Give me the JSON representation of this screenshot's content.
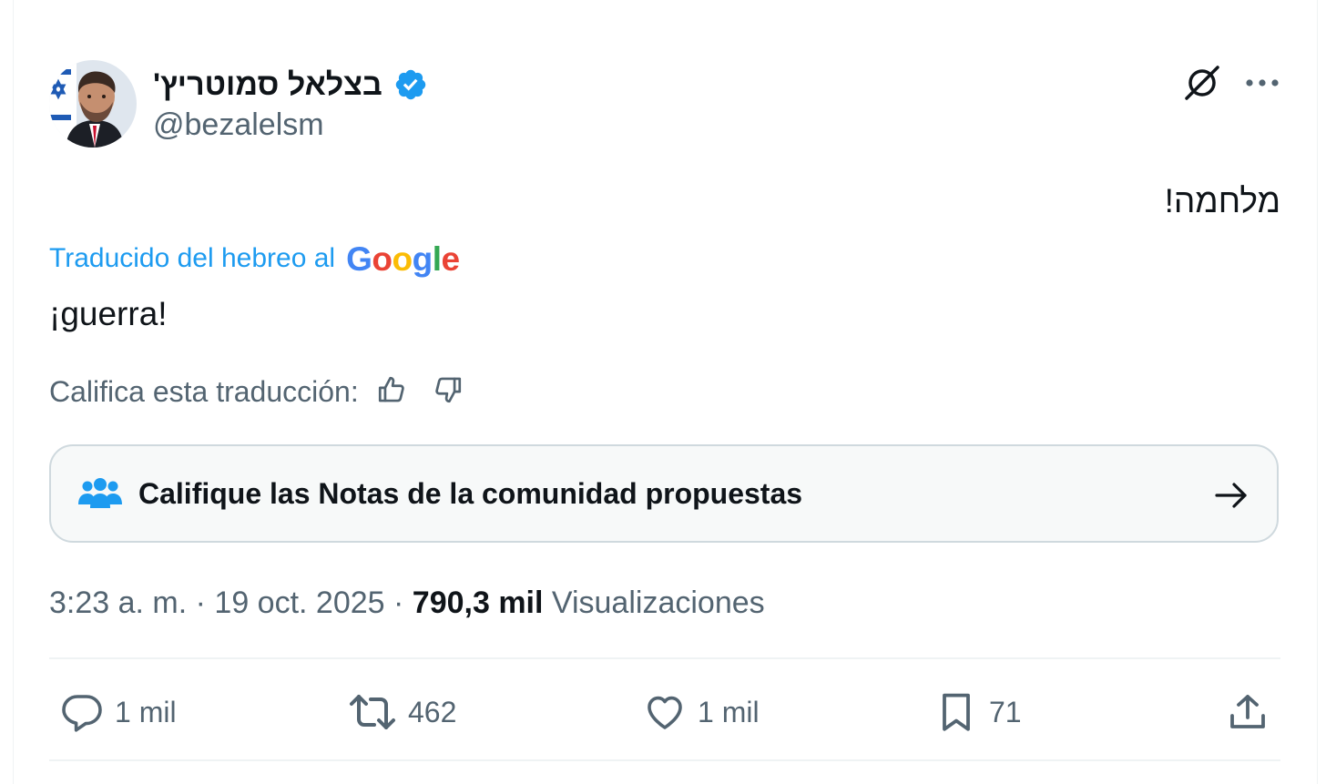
{
  "author": {
    "display_name": "בצלאל סמוטריץ'",
    "handle": "@bezalelsm",
    "verified_icon": "verified-badge-icon",
    "avatar_icon": "avatar-photo"
  },
  "header_actions": {
    "grok_icon": "grok-icon",
    "more_icon": "more-icon"
  },
  "tweet": {
    "original_text": "מלחמה!",
    "translated_label": "Traducido del hebreo al",
    "translator_logo": "Google",
    "translation": "¡guerra!"
  },
  "rate_translation": {
    "label": "Califica esta traducción:",
    "up_icon": "thumbs-up-icon",
    "down_icon": "thumbs-down-icon"
  },
  "community_notes": {
    "label": "Califique las Notas de la comunidad propuestas",
    "icon": "community-icon",
    "arrow_icon": "arrow-right-icon"
  },
  "meta": {
    "time": "3:23 a. m.",
    "separator": " · ",
    "date": "19 oct. 2025",
    "views_count": "790,3 mil",
    "views_label": "Visualizaciones"
  },
  "actions": {
    "replies": "1 mil",
    "reposts": "462",
    "likes": "1 mil",
    "bookmarks": "71"
  },
  "colors": {
    "accent": "#1d9bf0",
    "text": "#0f1419",
    "secondary": "#536471",
    "border": "#cfd9de",
    "card_bg": "#f7f9f9",
    "google_blue": "#4285f4",
    "google_red": "#ea4335",
    "google_yellow": "#fbbc05",
    "google_green": "#34a853"
  }
}
